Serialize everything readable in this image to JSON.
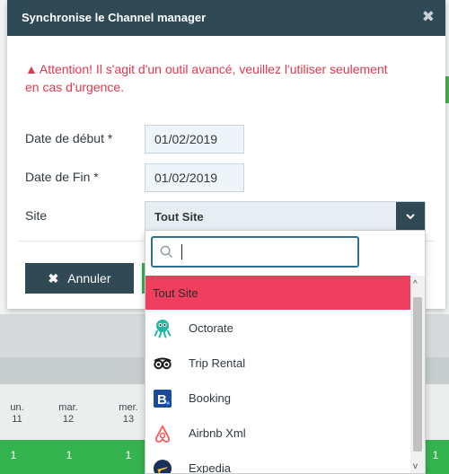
{
  "modal": {
    "title": "Synchronise le Channel manager",
    "warning": "Attention! Il s'agit d'un outil avancé, veuillez l'utiliser seulement en cas d'urgence."
  },
  "form": {
    "start_label": "Date de début *",
    "start_value": "01/02/2019",
    "end_label": "Date de Fin *",
    "end_value": "01/02/2019",
    "site_label": "Site",
    "site_value": "Tout Site"
  },
  "buttons": {
    "cancel": "Annuler"
  },
  "dropdown": {
    "search_value": "",
    "options": [
      {
        "label": "Tout Site",
        "icon": "none",
        "selected": true
      },
      {
        "label": "Octorate",
        "icon": "octorate-icon"
      },
      {
        "label": "Trip Rental",
        "icon": "tripadvisor-icon"
      },
      {
        "label": "Booking",
        "icon": "booking-icon"
      },
      {
        "label": "Airbnb Xml",
        "icon": "airbnb-icon"
      },
      {
        "label": "Expedia",
        "icon": "expedia-icon"
      }
    ]
  },
  "background_calendar": {
    "days": [
      {
        "name": "un.",
        "num": "11"
      },
      {
        "name": "mar.",
        "num": "12"
      },
      {
        "name": "mer.",
        "num": "13"
      }
    ],
    "cells": [
      "1",
      "1",
      "1",
      "1"
    ]
  },
  "colors": {
    "header": "#2f4955",
    "warning": "#e4374f",
    "selected": "#ef3f5f",
    "green": "#35b34e"
  }
}
